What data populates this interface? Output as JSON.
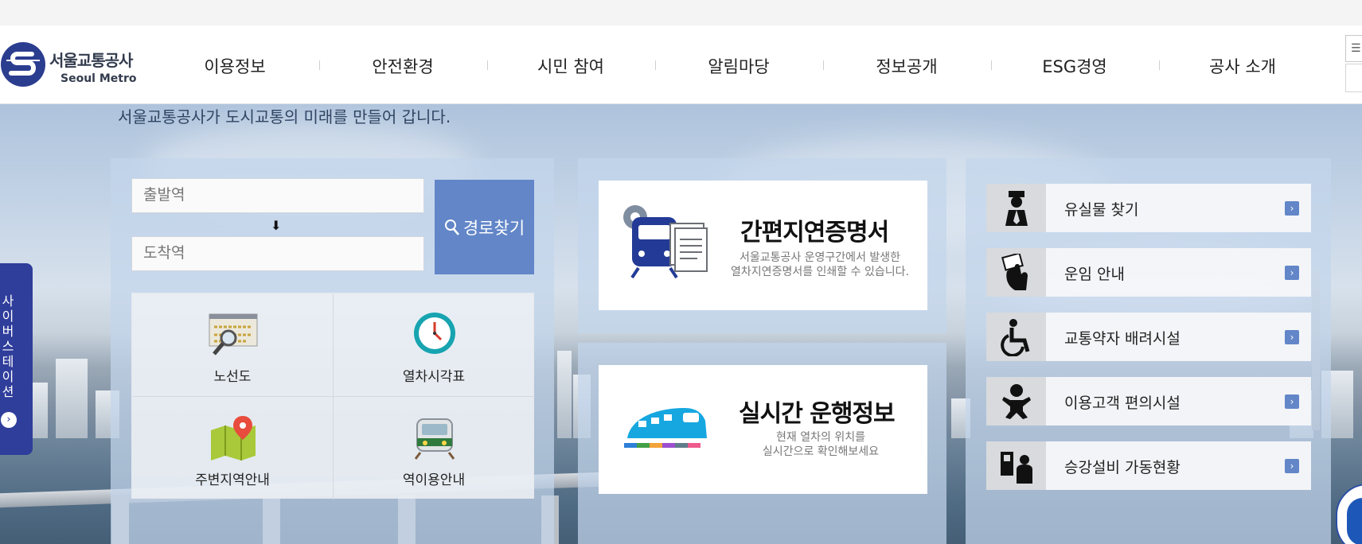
{
  "brand": {
    "name_ko": "서울교통공사",
    "name_en": "Seoul Metro",
    "color": "#2b3d8f"
  },
  "nav": {
    "items": [
      "이용정보",
      "안전환경",
      "시민 참여",
      "알림마당",
      "정보공개",
      "ESG경영",
      "공사 소개"
    ]
  },
  "hero": {
    "slogan": "서울교통공사가 도시교통의 미래를 만들어 갑니다."
  },
  "route_search": {
    "departure_placeholder": "출발역",
    "arrival_placeholder": "도착역",
    "arrow_icon": "arrow-down-icon",
    "button_label": "경로찾기",
    "button_color": "#6286c8"
  },
  "quick_links": [
    {
      "label": "노선도",
      "icon": "route-map-icon"
    },
    {
      "label": "열차시각표",
      "icon": "clock-icon"
    },
    {
      "label": "주변지역안내",
      "icon": "map-pin-icon"
    },
    {
      "label": "역이용안내",
      "icon": "train-front-icon"
    }
  ],
  "cards": {
    "delay_certificate": {
      "title": "간편지연증명서",
      "desc_line1": "서울교통공사 운영구간에서 발생한",
      "desc_line2": "열차지연증명서를 인쇄할 수 있습니다."
    },
    "realtime": {
      "title": "실시간 운행정보",
      "desc_line1": "현재 열차의 위치를",
      "desc_line2": "실시간으로 확인해보세요"
    }
  },
  "services": [
    {
      "label": "유실물 찾기",
      "icon": "staff-icon"
    },
    {
      "label": "운임 안내",
      "icon": "ticket-hand-icon"
    },
    {
      "label": "교통약자 배려시설",
      "icon": "wheelchair-icon"
    },
    {
      "label": "이용고객 편의시설",
      "icon": "baby-icon"
    },
    {
      "label": "승강설비 가동현황",
      "icon": "elevator-person-icon"
    }
  ],
  "sitemap": {
    "label": "사이버스테이션",
    "arrow": "›"
  },
  "service_go": "›"
}
